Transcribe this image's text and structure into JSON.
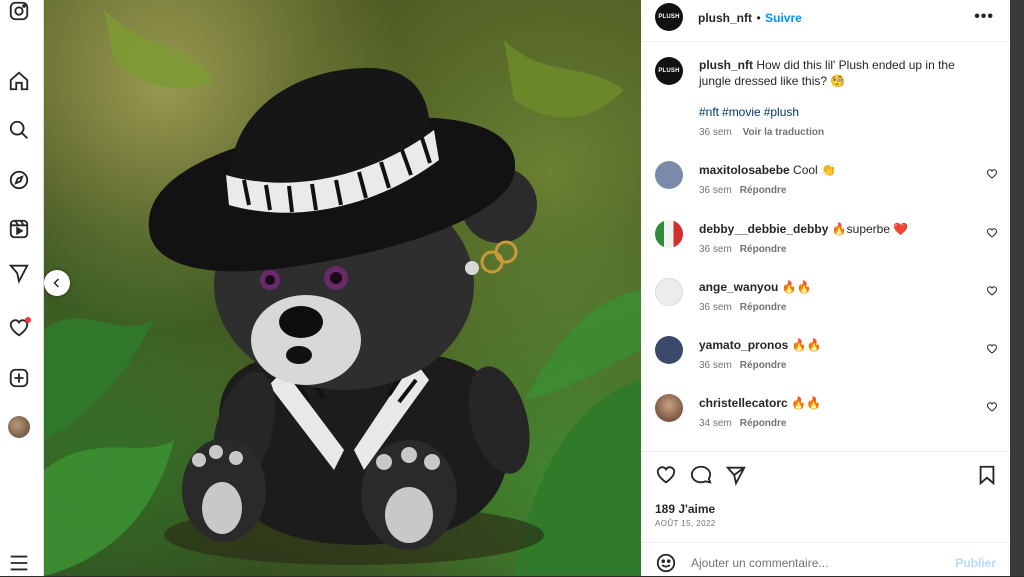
{
  "sidebar": {
    "icons": [
      "instagram-icon",
      "home-icon",
      "search-icon",
      "explore-icon",
      "reels-icon",
      "direct-icon",
      "notifications-icon",
      "create-icon",
      "profile-avatar",
      "menu-icon"
    ]
  },
  "post": {
    "account": "plush_nft",
    "avatar_text": "PLUSH",
    "separator": "•",
    "follow_label": "Suivre",
    "more_label": "•••",
    "caption_user": "plush_nft",
    "caption_text": "How did this lil' Plush ended up in the jungle dressed like this? 🧐",
    "hashtags": [
      "#nft",
      "#movie",
      "#plush"
    ],
    "caption_age": "36 sem",
    "translate_label": "Voir la traduction"
  },
  "comments": [
    {
      "user": "maxitolosabebe",
      "text": "Cool 👏",
      "age": "36 sem",
      "reply": "Répondre",
      "avatar_color": "#7a8aa8"
    },
    {
      "user": "debby__debbie_debby",
      "text": "🔥superbe ❤️",
      "age": "36 sem",
      "reply": "Répondre",
      "avatar_color": "#d9d9d9"
    },
    {
      "user": "ange_wanyou",
      "text": "🔥🔥",
      "age": "36 sem",
      "reply": "Répondre",
      "avatar_color": "#e6e6e6"
    },
    {
      "user": "yamato_pronos",
      "text": "🔥🔥",
      "age": "36 sem",
      "reply": "Répondre",
      "avatar_color": "#3b4a6b"
    },
    {
      "user": "christellecatorc",
      "text": "🔥🔥",
      "age": "34 sem",
      "reply": "Répondre",
      "avatar_color": "#6b4a3a"
    }
  ],
  "actions": {
    "likes": "189 J'aime",
    "date": "AOÛT 15, 2022",
    "comment_placeholder": "Ajouter un commentaire...",
    "publish_label": "Publier"
  },
  "colors": {
    "accent": "#0095f6",
    "hashtag": "#00376b",
    "muted": "#737373",
    "publish_disabled": "#b3dbff"
  }
}
